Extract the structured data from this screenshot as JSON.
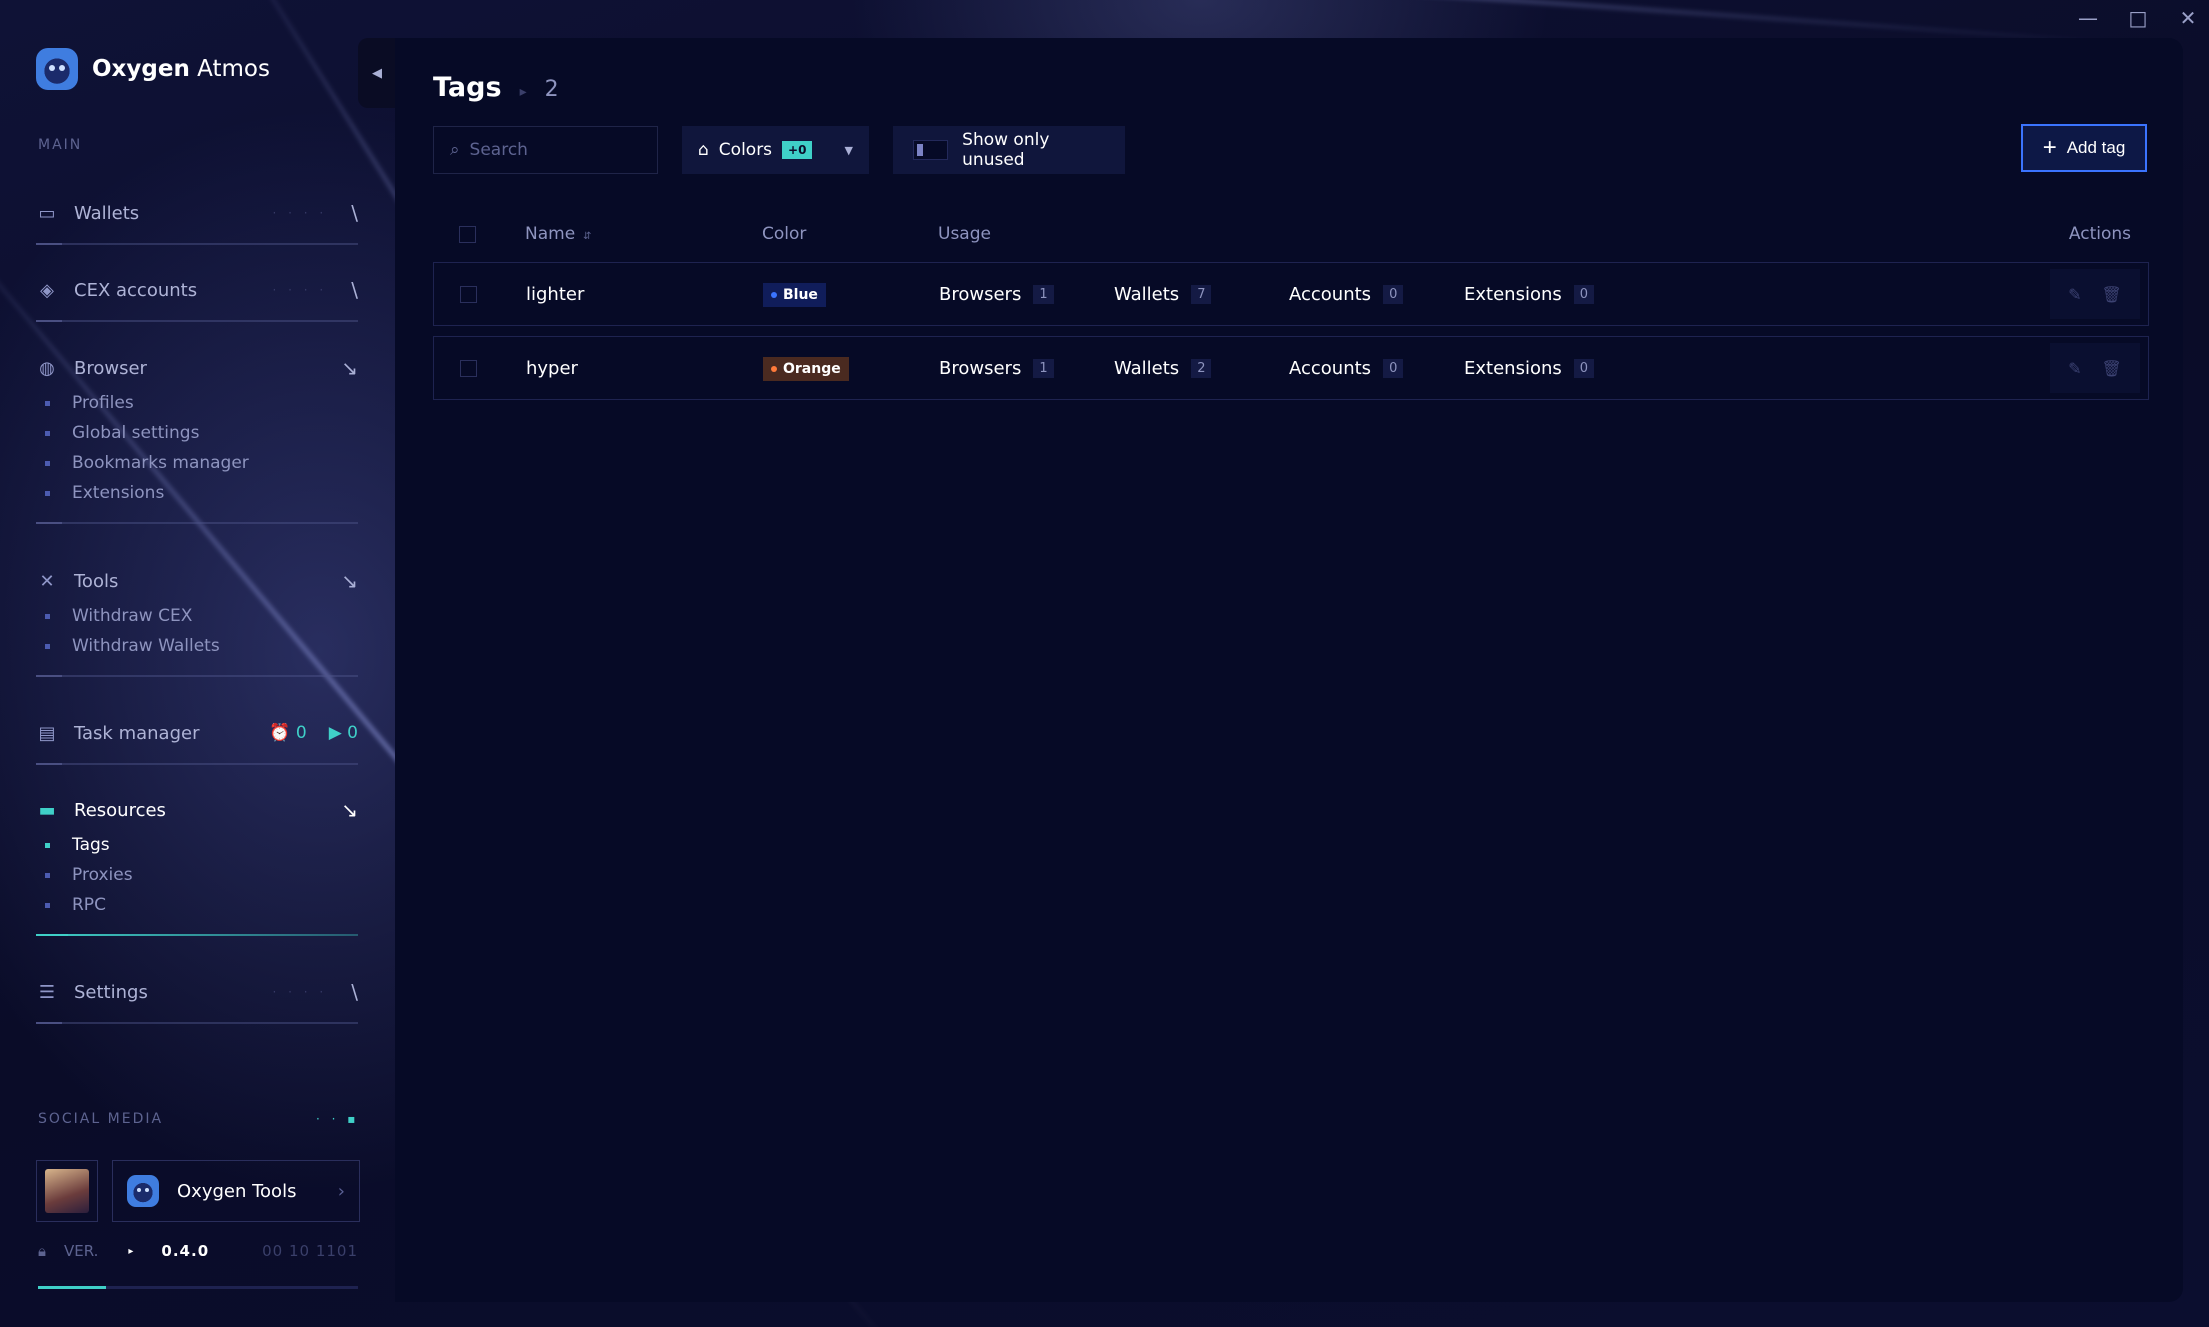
{
  "app": {
    "brand_bold": "Oxygen",
    "brand_light": "Atmos"
  },
  "window_controls": {
    "minimize": "—",
    "maximize": "□",
    "close": "✕"
  },
  "sidebar": {
    "main_label": "MAIN",
    "groups": {
      "wallets": {
        "label": "Wallets",
        "icon": "wallet-icon"
      },
      "cex": {
        "label": "CEX accounts",
        "icon": "layers-icon"
      },
      "browser": {
        "label": "Browser",
        "icon": "globe-icon",
        "items": [
          "Profiles",
          "Global settings",
          "Bookmarks manager",
          "Extensions"
        ]
      },
      "tools": {
        "label": "Tools",
        "icon": "tools-icon",
        "items": [
          "Withdraw CEX",
          "Withdraw Wallets"
        ]
      },
      "task_manager": {
        "label": "Task manager",
        "icon": "task-icon",
        "scheduled": "0",
        "running": "0"
      },
      "resources": {
        "label": "Resources",
        "icon": "folder-icon",
        "items": [
          "Tags",
          "Proxies",
          "RPC"
        ],
        "active_item": "Tags"
      },
      "settings": {
        "label": "Settings",
        "icon": "sliders-icon"
      }
    },
    "social_label": "SOCIAL MEDIA",
    "social_link": "Oxygen Tools",
    "version_label": "VER.",
    "version": "0.4.0",
    "version_code": "00 10 1101"
  },
  "page": {
    "title": "Tags",
    "count": "2"
  },
  "toolbar": {
    "search_placeholder": "Search",
    "colors_label": "Colors",
    "colors_badge": "+0",
    "toggle_label": "Show only unused",
    "add_label": "Add tag"
  },
  "table": {
    "headers": {
      "name": "Name",
      "color": "Color",
      "usage": "Usage",
      "actions": "Actions"
    },
    "rows": [
      {
        "name": "lighter",
        "color": "Blue",
        "color_hex": "#3b74ff",
        "usage": {
          "browsers_label": "Browsers",
          "browsers": "1",
          "wallets_label": "Wallets",
          "wallets": "7",
          "accounts_label": "Accounts",
          "accounts": "0",
          "extensions_label": "Extensions",
          "extensions": "0"
        }
      },
      {
        "name": "hyper",
        "color": "Orange",
        "color_hex": "#ff7a3a",
        "usage": {
          "browsers_label": "Browsers",
          "browsers": "1",
          "wallets_label": "Wallets",
          "wallets": "2",
          "accounts_label": "Accounts",
          "accounts": "0",
          "extensions_label": "Extensions",
          "extensions": "0"
        }
      }
    ]
  },
  "colors": {
    "accent": "#3fd0c8",
    "primary": "#3b74ff",
    "background": "#060a26"
  }
}
